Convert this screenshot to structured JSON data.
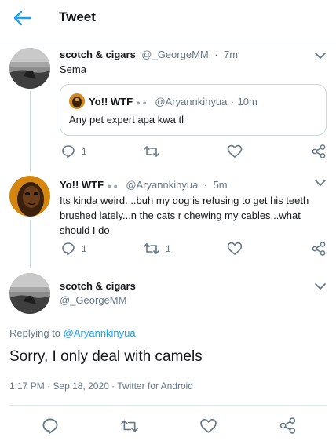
{
  "header": {
    "title": "Tweet"
  },
  "tweets": [
    {
      "name": "scotch & cigars",
      "handle": "@_GeorgeMM",
      "dot": "·",
      "time": "7m",
      "text": "Sema",
      "quote": {
        "name": "Yo!! WTF",
        "handle": "@Aryannkinyua",
        "dot": "·",
        "time": "10m",
        "text": "Any pet expert apa kwa tl"
      },
      "actions": {
        "replies": "1",
        "retweets": "",
        "likes": ""
      }
    },
    {
      "name": "Yo!! WTF",
      "handle": "@Aryannkinyua",
      "dot": "·",
      "time": "5m",
      "text": "Its kinda weird. ..buh my dog is refusing to get his teeth brushed lately...n the cats r chewing my cables...what should I do",
      "actions": {
        "replies": "1",
        "retweets": "1",
        "likes": ""
      }
    }
  ],
  "main_tweet": {
    "name": "scotch & cigars",
    "handle": "@_GeorgeMM",
    "replying_prefix": "Replying to ",
    "replying_to": "@Aryannkinyua",
    "text": "Sorry, I only deal with camels",
    "time": "1:17 PM",
    "dot": "·",
    "date": "Sep 18, 2020",
    "dot2": "·",
    "client": "Twitter for Android"
  },
  "colors": {
    "accent": "#1da1f2",
    "muted": "#657786",
    "text": "#14171a",
    "divider": "#e1e8ed"
  }
}
